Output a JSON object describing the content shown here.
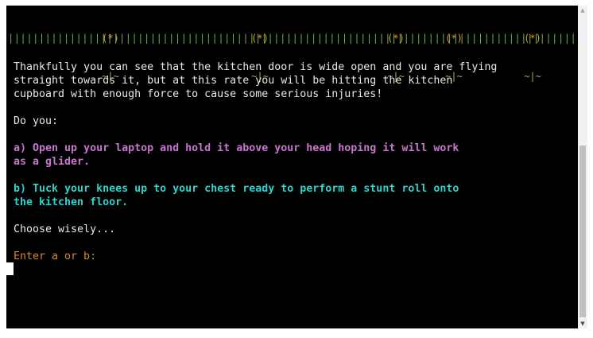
{
  "header": {
    "flowers": [
      {
        "head": "(*)",
        "stem": "~|~"
      },
      {
        "head": "(*)",
        "stem": "~|~"
      },
      {
        "head": "(*)",
        "stem": "~|~"
      },
      {
        "head": "(*)",
        "stem": "~|~"
      },
      {
        "head": "(*)",
        "stem": "~|~"
      }
    ],
    "grass": "|||||||||||||||||||||||||||||||||||||||||||||||||||||||||||||||||||||||||||||||||||||||||||||||||||||||||||||||||||||||||||||||||||||||||||||||||||||||||||||||||||||||||||||||||||||||||||||"
  },
  "story": {
    "line1": "Thankfully you can see that the kitchen door is wide open and you are flying",
    "line2": "straight towards it, but at this rate you will be hitting the kitchen",
    "line3": "cupboard with enough force to cause some serious injuries!"
  },
  "prompt": {
    "do_you": "Do you:",
    "option_a_line1": "a) Open up your laptop and hold it above your head hoping it will work",
    "option_a_line2": "as a glider.",
    "option_b_line1": "b) Tuck your knees up to your chest ready to perform a stunt roll onto",
    "option_b_line2": "the kitchen floor.",
    "choose": "Choose wisely...",
    "input_label": "Enter a or b:"
  },
  "colors": {
    "background": "#000000",
    "text": "#e8e8e8",
    "option_a": "#c677cc",
    "option_b": "#2fd2cf",
    "input_prompt": "#d28a2a",
    "flower_head": "#e0a020",
    "grass": "#6cb04a"
  },
  "icons": {
    "scroll_up": "triangle-up-icon",
    "scroll_down": "triangle-down-icon"
  }
}
